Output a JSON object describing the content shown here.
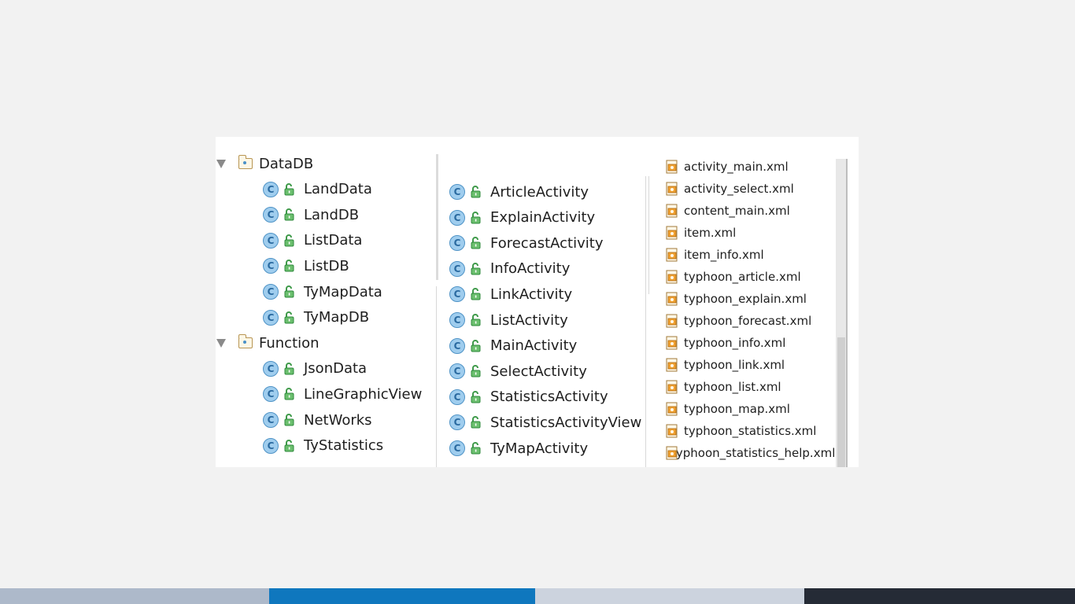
{
  "col1": {
    "groups": [
      {
        "label": "DataDB",
        "items": [
          "LandData",
          "LandDB",
          "ListData",
          "ListDB",
          "TyMapData",
          "TyMapDB"
        ]
      },
      {
        "label": "Function",
        "items": [
          "JsonData",
          "LineGraphicView",
          "NetWorks",
          "TyStatistics"
        ]
      }
    ]
  },
  "col2": {
    "items": [
      "ArticleActivity",
      "ExplainActivity",
      "ForecastActivity",
      "InfoActivity",
      "LinkActivity",
      "ListActivity",
      "MainActivity",
      "SelectActivity",
      "StatisticsActivity",
      "StatisticsActivityView",
      "TyMapActivity"
    ]
  },
  "col3": {
    "files": [
      "activity_main.xml",
      "activity_select.xml",
      "content_main.xml",
      "item.xml",
      "item_info.xml",
      "typhoon_article.xml",
      "typhoon_explain.xml",
      "typhoon_forecast.xml",
      "typhoon_info.xml",
      "typhoon_link.xml",
      "typhoon_list.xml",
      "typhoon_map.xml",
      "typhoon_statistics.xml",
      "typhoon_statistics_help.xml"
    ]
  },
  "icons": {
    "class_glyph": "C",
    "class_icon": "class-icon",
    "lock_icon": "unlocked-icon",
    "folder_icon": "package-folder-icon",
    "expand_icon": "expand-arrow-icon",
    "xml_icon": "xml-file-icon"
  },
  "colors": {
    "page_bg": "#f2f2f2",
    "bar1": "#adb9ca",
    "bar2": "#0f77be",
    "bar3": "#ccd3de",
    "bar4": "#252b36"
  }
}
